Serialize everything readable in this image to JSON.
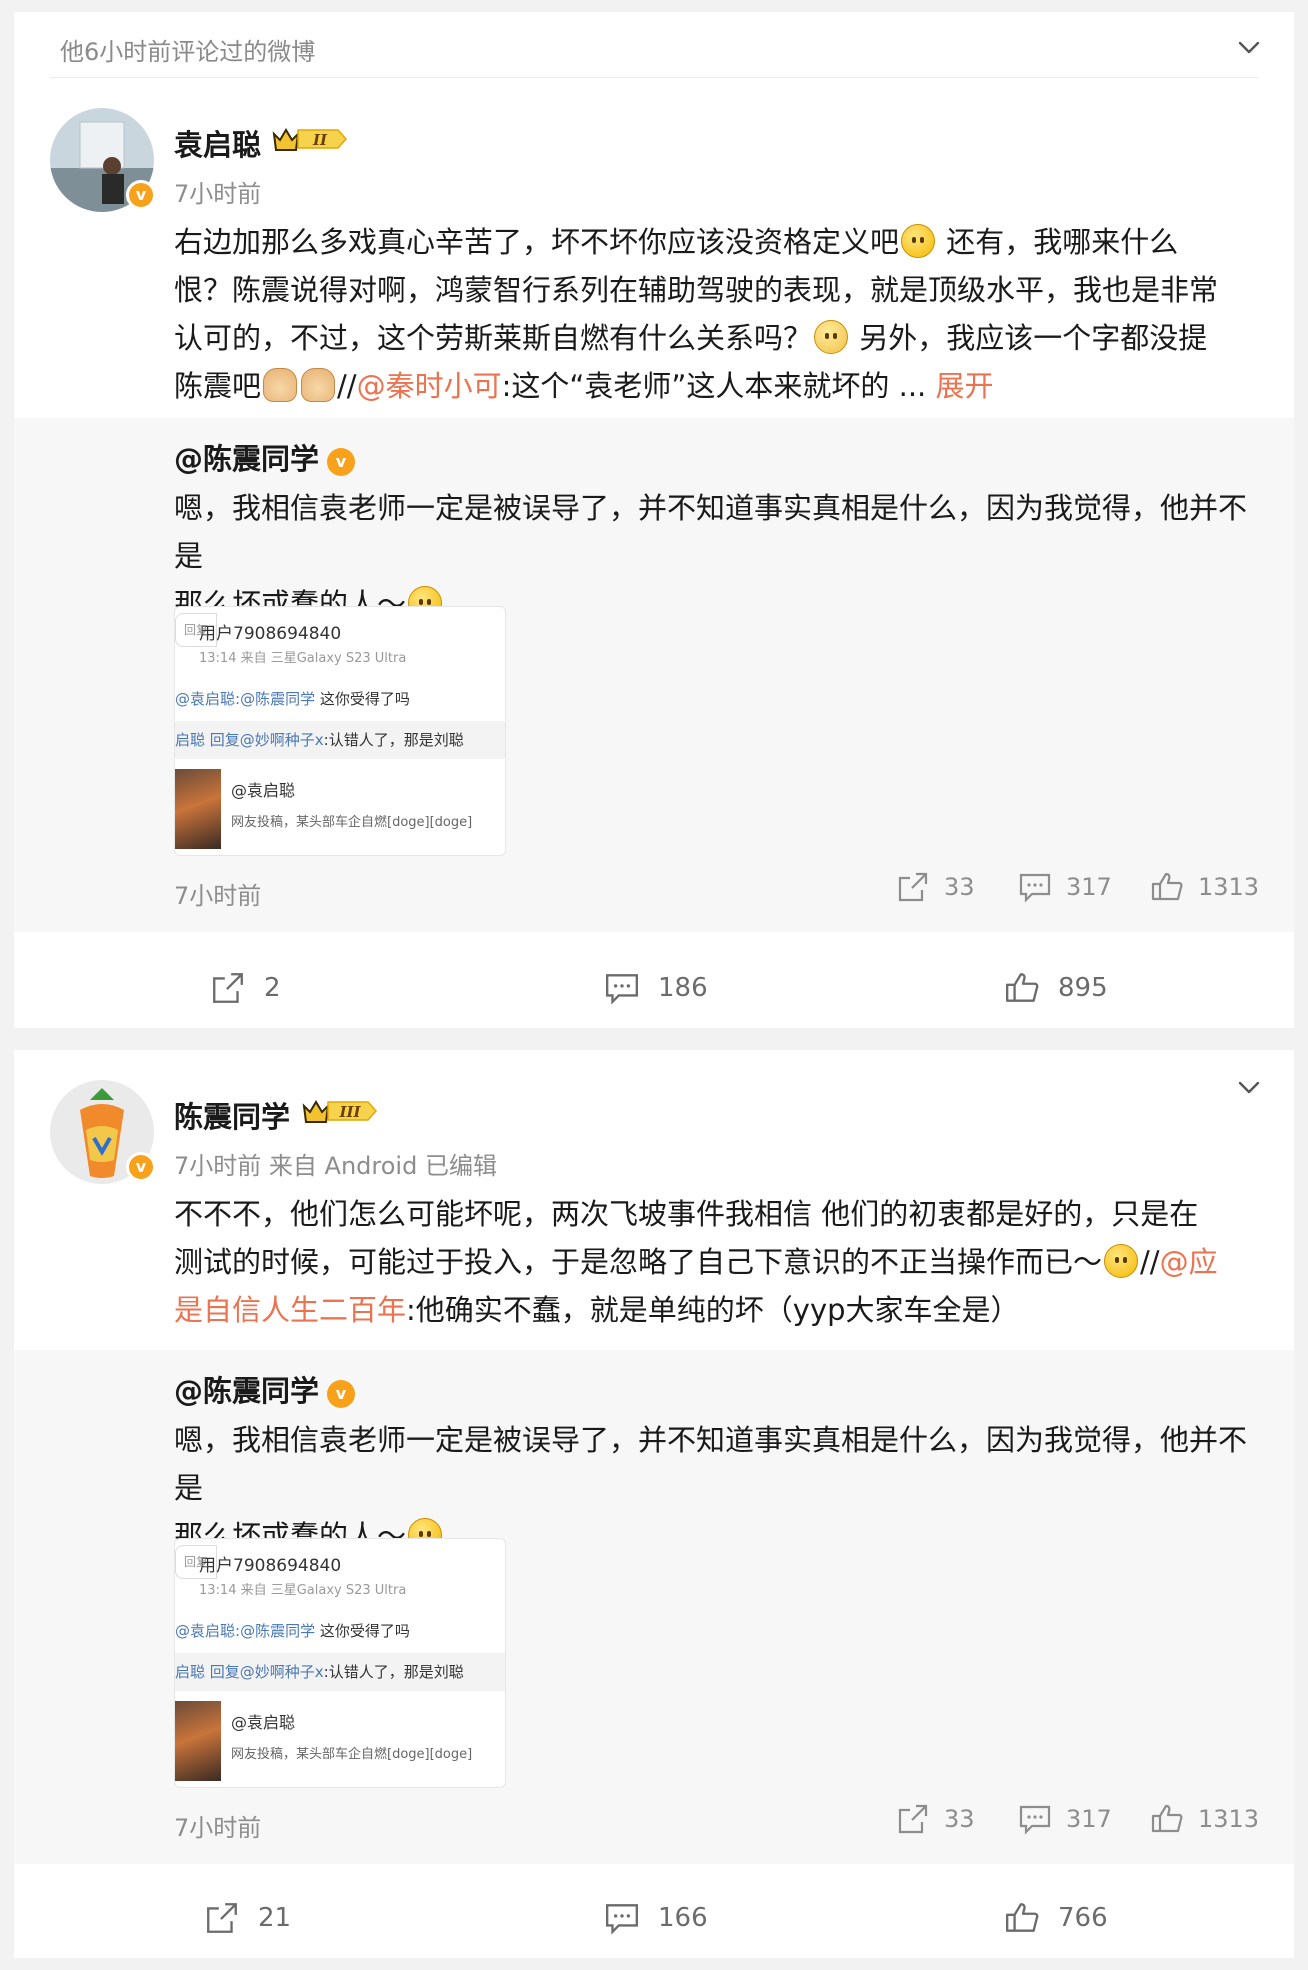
{
  "section": {
    "title": "他6小时前评论过的微博"
  },
  "post1": {
    "username": "袁启聪",
    "level": "II",
    "time": "7小时前",
    "text": {
      "p1": "右边加那么多戏真心辛苦了，坏不坏你应该没资格定义吧",
      "p2": " 还有，我哪来什么",
      "p3": "恨？陈震说得对啊，鸿蒙智行系列在辅助驾驶的表现，就是顶级水平，我也是非常",
      "p4": "认可的，不过，这个劳斯莱斯自燃有什么关系吗？",
      "p5": " 另外，我应该一个字都没提",
      "p6": "陈震吧",
      "p7": "//",
      "mention": "@秦时小可",
      "p8": ":这个“袁老师”这人本来就坏的 ... ",
      "expand": "展开"
    },
    "repost": {
      "name": "@陈震同学",
      "text_l1": "嗯，我相信袁老师一定是被误导了，并不知道事实真相是什么，因为我觉得，他并不是",
      "text_l2": "那么坏或蠢的人～",
      "thumb": {
        "user": "用户7908694840",
        "time": "13:14  来自 三星Galaxy S23 Ultra",
        "reply": "回复",
        "line1_a": "@袁启聪:",
        "line1_b": "@陈震同学",
        "line1_c": " 这你受得了吗",
        "line2_a": "启聪 回复",
        "line2_b": "@妙啊种子x",
        "line2_c": ":认错人了，那是刘聪",
        "at": "@袁启聪",
        "desc": "网友投稿，某头部车企自燃[doge][doge]"
      },
      "time": "7小时前",
      "reposts": "33",
      "comments": "317",
      "likes": "1313"
    },
    "actions": {
      "reposts": "2",
      "comments": "186",
      "likes": "895"
    }
  },
  "post2": {
    "username": "陈震同学",
    "level": "III",
    "meta": "7小时前 来自 Android 已编辑",
    "text": {
      "l1": "不不不，他们怎么可能坏呢，两次飞坡事件我相信 他们的初衷都是好的，只是在",
      "l2a": "测试的时候，可能过于投入，于是忽略了自己下意识的不正当操作而已～",
      "l2b": "//",
      "mention_a": "@应",
      "mention_b": "是自信人生二百年",
      "l3": ":他确实不蠢，就是单纯的坏（yyp大家车全是）"
    },
    "repost": {
      "name": "@陈震同学",
      "text_l1": "嗯，我相信袁老师一定是被误导了，并不知道事实真相是什么，因为我觉得，他并不是",
      "text_l2": "那么坏或蠢的人～",
      "thumb": {
        "user": "用户7908694840",
        "time": "13:14  来自 三星Galaxy S23 Ultra",
        "reply": "回复",
        "line1_a": "@袁启聪:",
        "line1_b": "@陈震同学",
        "line1_c": " 这你受得了吗",
        "line2_a": "启聪 回复",
        "line2_b": "@妙啊种子x",
        "line2_c": ":认错人了，那是刘聪",
        "at": "@袁启聪",
        "desc": "网友投稿，某头部车企自燃[doge][doge]"
      },
      "time": "7小时前",
      "reposts": "33",
      "comments": "317",
      "likes": "1313"
    },
    "actions": {
      "reposts": "21",
      "comments": "166",
      "likes": "766"
    }
  },
  "icons": {
    "share": "share-icon",
    "comment": "comment-icon",
    "like": "like-icon",
    "chevron": "chevron-down-icon",
    "verified": "verified-badge-icon",
    "crown": "crown-level-icon"
  },
  "colors": {
    "link": "#eb7350",
    "verified": "#f7a21a",
    "background": "#f2f2f2",
    "repost_bg": "#f7f7f7"
  }
}
